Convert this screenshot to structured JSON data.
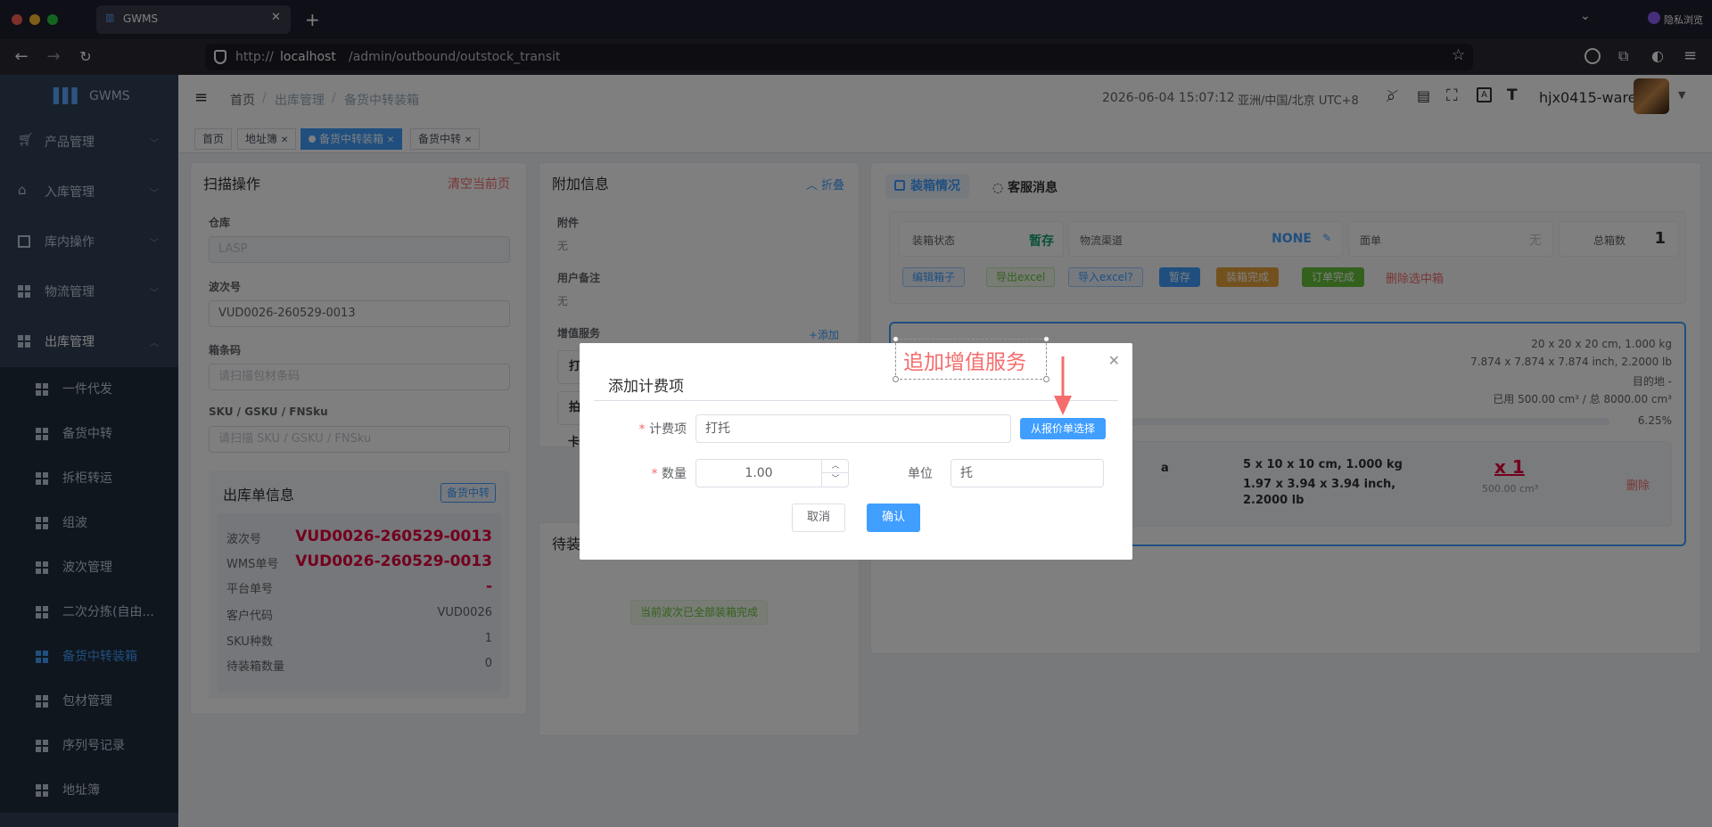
{
  "browser": {
    "tab_title": "GWMS",
    "url_prefix": "http://",
    "url_host": "localhost",
    "url_path": "/admin/outbound/outstock_transit",
    "private_label": "隐私浏览"
  },
  "sidebar": {
    "logo": "GWMS",
    "menus": [
      {
        "label": "产品管理"
      },
      {
        "label": "入库管理"
      },
      {
        "label": "库内操作"
      },
      {
        "label": "物流管理"
      },
      {
        "label": "出库管理"
      }
    ],
    "subs": [
      {
        "label": "一件代发"
      },
      {
        "label": "备货中转"
      },
      {
        "label": "拆柜转运"
      },
      {
        "label": "组波"
      },
      {
        "label": "波次管理"
      },
      {
        "label": "二次分拣(自由..."
      },
      {
        "label": "备货中转装箱"
      },
      {
        "label": "包材管理"
      },
      {
        "label": "序列号记录"
      },
      {
        "label": "地址簿"
      }
    ]
  },
  "navbar": {
    "crumbs": [
      "首页",
      "出库管理",
      "备货中转装箱"
    ],
    "sep": "/",
    "datetime": "2026-06-04 15:07:12",
    "timezone": "亚洲/中国/北京 UTC+8",
    "user": "hjx0415-ware"
  },
  "tags": [
    {
      "label": "首页"
    },
    {
      "label": "地址簿"
    },
    {
      "label": "备货中转装箱"
    },
    {
      "label": "备货中转"
    }
  ],
  "scan": {
    "title": "扫描操作",
    "clear": "清空当前页",
    "warehouse_label": "仓库",
    "warehouse_value": "LASP",
    "wave_label": "波次号",
    "wave_value": "VUD0026-260529-0013",
    "box_label": "箱条码",
    "box_placeholder": "请扫描包材条码",
    "sku_label": "SKU / GSKU / FNSku",
    "sku_placeholder": "请扫描 SKU / GSKU / FNSku"
  },
  "order": {
    "title": "出库单信息",
    "badge": "备货中转",
    "rows": [
      {
        "k": "波次号",
        "v": "VUD0026-260529-0013"
      },
      {
        "k": "WMS单号",
        "v": "VUD0026-260529-0013"
      },
      {
        "k": "平台单号",
        "v": "-"
      },
      {
        "k": "客户代码",
        "v": "VUD0026"
      },
      {
        "k": "SKU种数",
        "v": "1"
      },
      {
        "k": "待装箱数量",
        "v": "0"
      }
    ]
  },
  "extra": {
    "title": "附加信息",
    "fold": "折叠",
    "attach_label": "附件",
    "attach_value": "无",
    "remark_label": "用户备注",
    "remark_value": "无",
    "vas_label": "增值服务",
    "vas_add": "+添加",
    "vas_rows": [
      "打",
      "拍",
      "卡"
    ],
    "pending_title": "待装",
    "pending_done": "当前波次已全部装箱完成"
  },
  "pack": {
    "tab1": "装箱情况",
    "tab2": "客服消息",
    "status_label": "装箱状态",
    "status_value": "暂存",
    "channel_label": "物流渠道",
    "channel_value": "NONE",
    "label_label": "面单",
    "label_value": "无",
    "total_label": "总箱数",
    "total_value": "1",
    "btns": {
      "edit": "编辑箱子",
      "export": "导出excel",
      "import": "导入excel?",
      "stash": "暂存",
      "done": "装箱完成",
      "order_done": "订单完成",
      "delete": "删除选中箱"
    },
    "box_dim": "20 x 20 x 20 cm, 1.000 kg",
    "box_dim_in": "7.874 x 7.874 x 7.874 inch, 2.2000 lb",
    "dest": "目的地 -",
    "usage": "已用 500.00 cm³ / 总 8000.00 cm³",
    "percent": "6.25%",
    "item_dim": "5 x 10 x 10 cm, 1.000 kg",
    "item_dim_in1": "1.97 x 3.94 x 3.94 inch,",
    "item_dim_in2": "2.2000 lb",
    "item_extra": "a",
    "qty": "x 1",
    "vol": "500.00 cm³",
    "item_delete": "删除"
  },
  "dialog": {
    "title": "添加计费项",
    "fee_label": "计费项",
    "fee_value": "打托",
    "pick_btn": "从报价单选择",
    "qty_label": "数量",
    "qty_value": "1.00",
    "unit_label": "单位",
    "unit_value": "托",
    "cancel": "取消",
    "confirm": "确认",
    "required": "*"
  },
  "annotation": {
    "text": "追加增值服务",
    "color": "#f56c6c"
  },
  "progress": {
    "percent": 6.25
  }
}
